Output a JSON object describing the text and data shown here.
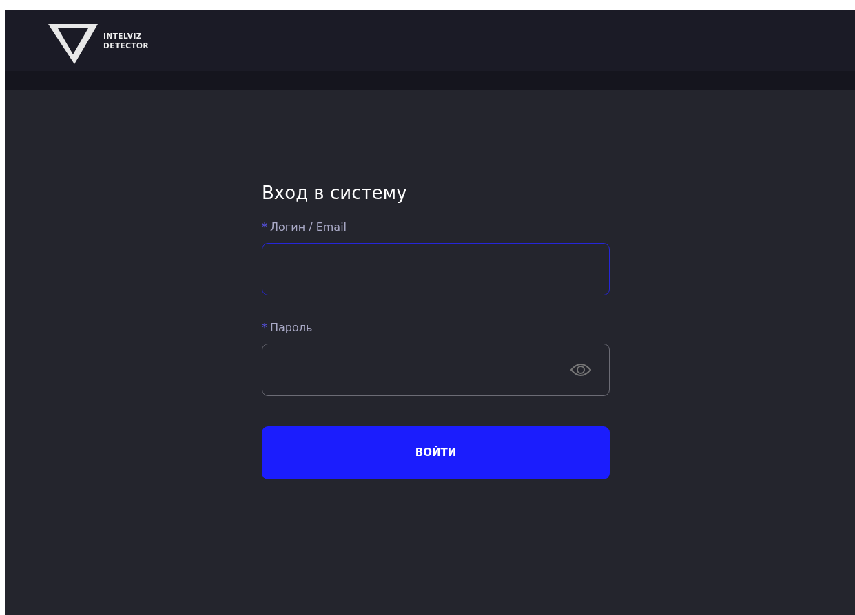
{
  "header": {
    "logo_text": [
      "INTELVIZ",
      "DETECTOR"
    ]
  },
  "form": {
    "title": "Вход в систему",
    "fields": [
      {
        "kind": "text",
        "required_mark": "*",
        "label": "Логин / Email",
        "focused": true
      },
      {
        "kind": "password",
        "required_mark": "*",
        "label": "Пароль",
        "focused": false
      }
    ],
    "submit": "ВОЙТИ"
  }
}
